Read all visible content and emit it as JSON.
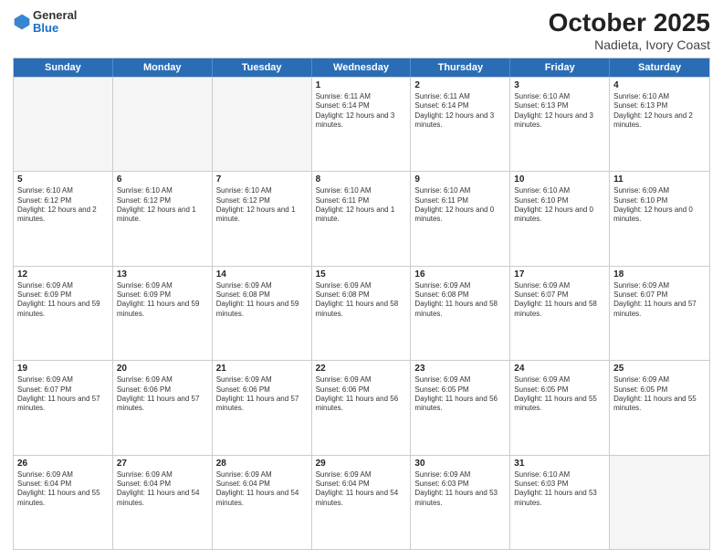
{
  "header": {
    "logo_general": "General",
    "logo_blue": "Blue",
    "month": "October 2025",
    "location": "Nadieta, Ivory Coast"
  },
  "days_of_week": [
    "Sunday",
    "Monday",
    "Tuesday",
    "Wednesday",
    "Thursday",
    "Friday",
    "Saturday"
  ],
  "weeks": [
    [
      {
        "day": "",
        "info": ""
      },
      {
        "day": "",
        "info": ""
      },
      {
        "day": "",
        "info": ""
      },
      {
        "day": "1",
        "info": "Sunrise: 6:11 AM\nSunset: 6:14 PM\nDaylight: 12 hours and 3 minutes."
      },
      {
        "day": "2",
        "info": "Sunrise: 6:11 AM\nSunset: 6:14 PM\nDaylight: 12 hours and 3 minutes."
      },
      {
        "day": "3",
        "info": "Sunrise: 6:10 AM\nSunset: 6:13 PM\nDaylight: 12 hours and 3 minutes."
      },
      {
        "day": "4",
        "info": "Sunrise: 6:10 AM\nSunset: 6:13 PM\nDaylight: 12 hours and 2 minutes."
      }
    ],
    [
      {
        "day": "5",
        "info": "Sunrise: 6:10 AM\nSunset: 6:12 PM\nDaylight: 12 hours and 2 minutes."
      },
      {
        "day": "6",
        "info": "Sunrise: 6:10 AM\nSunset: 6:12 PM\nDaylight: 12 hours and 1 minute."
      },
      {
        "day": "7",
        "info": "Sunrise: 6:10 AM\nSunset: 6:12 PM\nDaylight: 12 hours and 1 minute."
      },
      {
        "day": "8",
        "info": "Sunrise: 6:10 AM\nSunset: 6:11 PM\nDaylight: 12 hours and 1 minute."
      },
      {
        "day": "9",
        "info": "Sunrise: 6:10 AM\nSunset: 6:11 PM\nDaylight: 12 hours and 0 minutes."
      },
      {
        "day": "10",
        "info": "Sunrise: 6:10 AM\nSunset: 6:10 PM\nDaylight: 12 hours and 0 minutes."
      },
      {
        "day": "11",
        "info": "Sunrise: 6:09 AM\nSunset: 6:10 PM\nDaylight: 12 hours and 0 minutes."
      }
    ],
    [
      {
        "day": "12",
        "info": "Sunrise: 6:09 AM\nSunset: 6:09 PM\nDaylight: 11 hours and 59 minutes."
      },
      {
        "day": "13",
        "info": "Sunrise: 6:09 AM\nSunset: 6:09 PM\nDaylight: 11 hours and 59 minutes."
      },
      {
        "day": "14",
        "info": "Sunrise: 6:09 AM\nSunset: 6:08 PM\nDaylight: 11 hours and 59 minutes."
      },
      {
        "day": "15",
        "info": "Sunrise: 6:09 AM\nSunset: 6:08 PM\nDaylight: 11 hours and 58 minutes."
      },
      {
        "day": "16",
        "info": "Sunrise: 6:09 AM\nSunset: 6:08 PM\nDaylight: 11 hours and 58 minutes."
      },
      {
        "day": "17",
        "info": "Sunrise: 6:09 AM\nSunset: 6:07 PM\nDaylight: 11 hours and 58 minutes."
      },
      {
        "day": "18",
        "info": "Sunrise: 6:09 AM\nSunset: 6:07 PM\nDaylight: 11 hours and 57 minutes."
      }
    ],
    [
      {
        "day": "19",
        "info": "Sunrise: 6:09 AM\nSunset: 6:07 PM\nDaylight: 11 hours and 57 minutes."
      },
      {
        "day": "20",
        "info": "Sunrise: 6:09 AM\nSunset: 6:06 PM\nDaylight: 11 hours and 57 minutes."
      },
      {
        "day": "21",
        "info": "Sunrise: 6:09 AM\nSunset: 6:06 PM\nDaylight: 11 hours and 57 minutes."
      },
      {
        "day": "22",
        "info": "Sunrise: 6:09 AM\nSunset: 6:06 PM\nDaylight: 11 hours and 56 minutes."
      },
      {
        "day": "23",
        "info": "Sunrise: 6:09 AM\nSunset: 6:05 PM\nDaylight: 11 hours and 56 minutes."
      },
      {
        "day": "24",
        "info": "Sunrise: 6:09 AM\nSunset: 6:05 PM\nDaylight: 11 hours and 55 minutes."
      },
      {
        "day": "25",
        "info": "Sunrise: 6:09 AM\nSunset: 6:05 PM\nDaylight: 11 hours and 55 minutes."
      }
    ],
    [
      {
        "day": "26",
        "info": "Sunrise: 6:09 AM\nSunset: 6:04 PM\nDaylight: 11 hours and 55 minutes."
      },
      {
        "day": "27",
        "info": "Sunrise: 6:09 AM\nSunset: 6:04 PM\nDaylight: 11 hours and 54 minutes."
      },
      {
        "day": "28",
        "info": "Sunrise: 6:09 AM\nSunset: 6:04 PM\nDaylight: 11 hours and 54 minutes."
      },
      {
        "day": "29",
        "info": "Sunrise: 6:09 AM\nSunset: 6:04 PM\nDaylight: 11 hours and 54 minutes."
      },
      {
        "day": "30",
        "info": "Sunrise: 6:09 AM\nSunset: 6:03 PM\nDaylight: 11 hours and 53 minutes."
      },
      {
        "day": "31",
        "info": "Sunrise: 6:10 AM\nSunset: 6:03 PM\nDaylight: 11 hours and 53 minutes."
      },
      {
        "day": "",
        "info": ""
      }
    ]
  ]
}
